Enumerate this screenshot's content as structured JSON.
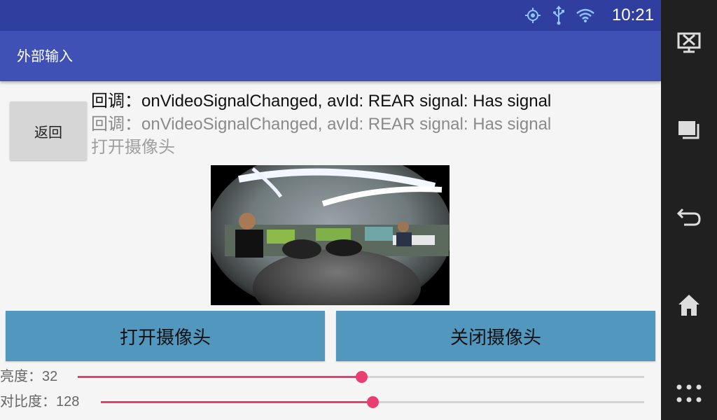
{
  "status_bar": {
    "time": "10:21",
    "icons": [
      "gps-icon",
      "usb-icon",
      "wifi-icon"
    ]
  },
  "app_bar": {
    "title": "外部输入"
  },
  "content": {
    "back_button": "返回",
    "log_lines": [
      "回调：onVideoSignalChanged, avId: REAR signal: Has signal",
      "回调：onVideoSignalChanged, avId: REAR signal: Has signal",
      "打开摄像头"
    ],
    "open_camera_button": "打开摄像头",
    "close_camera_button": "关闭摄像头",
    "brightness": {
      "label": "亮度：32",
      "value": 32,
      "max": 64,
      "fraction": 0.5
    },
    "contrast": {
      "label": "对比度：128",
      "value": 128,
      "max": 255,
      "fraction": 0.5
    }
  },
  "nav_bar": {
    "icons": [
      "screenshot-icon",
      "recent-apps-icon",
      "back-icon",
      "home-icon",
      "apps-grid-icon"
    ]
  },
  "colors": {
    "status_bar": "#303f9f",
    "app_bar": "#3f51b5",
    "button_blue": "#5197be",
    "slider_accent": "#e83e70",
    "nav_bar": "#202020"
  }
}
